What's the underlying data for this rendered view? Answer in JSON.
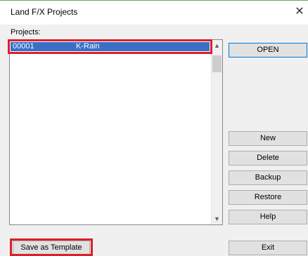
{
  "window": {
    "title": "Land F/X Projects",
    "close_symbol": "✕"
  },
  "projects": {
    "label": "Projects:",
    "items": [
      {
        "number": "00001",
        "name": "K-Rain",
        "selected": true
      }
    ]
  },
  "scrollbar": {
    "up_arrow": "▲",
    "down_arrow": "▼"
  },
  "buttons": {
    "open": "OPEN",
    "new": "New",
    "delete": "Delete",
    "backup": "Backup",
    "restore": "Restore",
    "help": "Help",
    "exit": "Exit",
    "save_as_template": "Save as Template"
  },
  "colors": {
    "selection": "#3b6fc6",
    "highlight": "#d9202a",
    "focus_border": "#0078d7"
  }
}
